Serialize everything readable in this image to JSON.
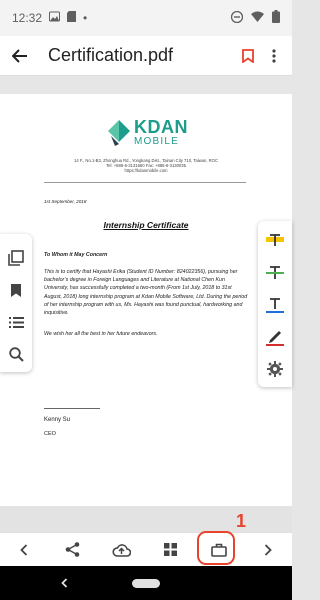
{
  "status_bar": {
    "time": "12:32",
    "dot": "•"
  },
  "app_bar": {
    "title": "Certification.pdf"
  },
  "document": {
    "logo_brand": "KDAN",
    "logo_sub": "MOBILE",
    "address_line1": "14 F., No.1-B3, Zhonghua Rd., Yongkang Dist., Tainan City 710, Taiwan, ROC",
    "address_line2": "Tel: +886-6-3131660     Fax: +886-6-3130035",
    "address_line3": "https://kdanmobile.com",
    "date": "1st September, 2018",
    "title": "Internship Certificate",
    "salutation": "To Whom it May Concern",
    "body": "This is to certify that Hayashi Erika (Student ID Number: 824022356), pursuing her bachelor’s degree in Foreign Languages and Literature at National Chen Kun University, has successfully completed a two-month (From 1st July, 2018 to 31st August, 2018) long internship program at Kdan Mobile Software, Ltd. During the period of her internship program with us, Ms. Hayashi was found punctual, hardworking and inquisitive.",
    "closing": "We wish her all the best in her future endeavors.",
    "signer_name": "Kenny  Su",
    "signer_role": "CEO"
  },
  "annotation": {
    "number": "1"
  },
  "colors": {
    "accent_red": "#e8432d",
    "brand_teal": "#1d9d8b",
    "highlight_yellow": "#f5c400",
    "strike_green": "#4caf50",
    "underline_blue": "#1e6fd9",
    "pen_red": "#d32f2f"
  }
}
